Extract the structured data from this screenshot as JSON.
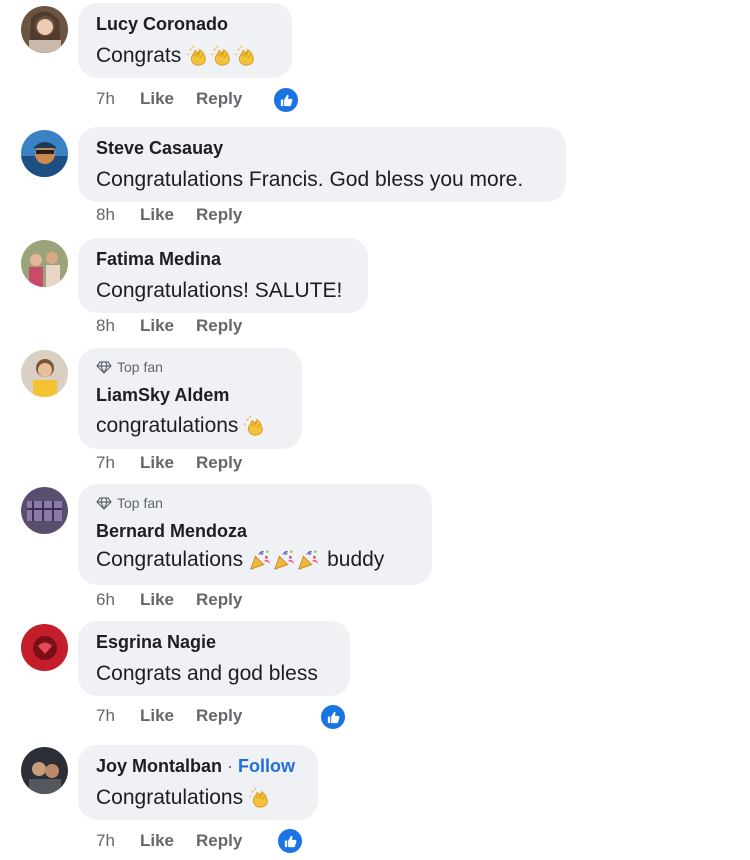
{
  "comments": [
    {
      "author": "Lucy Coronado",
      "text": "Congrats",
      "time": "7h",
      "like": "Like",
      "reply": "Reply",
      "emojis": "clap x3",
      "reaction": "like-icon"
    },
    {
      "author": "Steve Casauay",
      "text": "Congratulations Francis. God bless you more.",
      "time": "8h",
      "like": "Like",
      "reply": "Reply"
    },
    {
      "author": "Fatima Medina",
      "text": "Congratulations! SALUTE!",
      "time": "8h",
      "like": "Like",
      "reply": "Reply"
    },
    {
      "badge": "Top fan",
      "author": "LiamSky Aldem",
      "text": "congratulations",
      "time": "7h",
      "like": "Like",
      "reply": "Reply",
      "emojis": "clap x1"
    },
    {
      "badge": "Top fan",
      "author": "Bernard Mendoza",
      "text": "Congratulations",
      "text_after": "buddy",
      "time": "6h",
      "like": "Like",
      "reply": "Reply",
      "emojis": "party-popper x3"
    },
    {
      "author": "Esgrina Nagie",
      "text": "Congrats and god bless",
      "time": "7h",
      "like": "Like",
      "reply": "Reply",
      "reaction": "like-icon"
    },
    {
      "author": "Joy Montalban",
      "follow_dot": "·",
      "follow": "Follow",
      "text": "Congratulations",
      "time": "7h",
      "like": "Like",
      "reply": "Reply",
      "emojis": "clap x1",
      "reaction": "like-icon"
    }
  ],
  "colors": {
    "bubble": "#eff1f4",
    "accent": "#1b74e4",
    "link": "#216fdb",
    "meta": "#65676b"
  }
}
